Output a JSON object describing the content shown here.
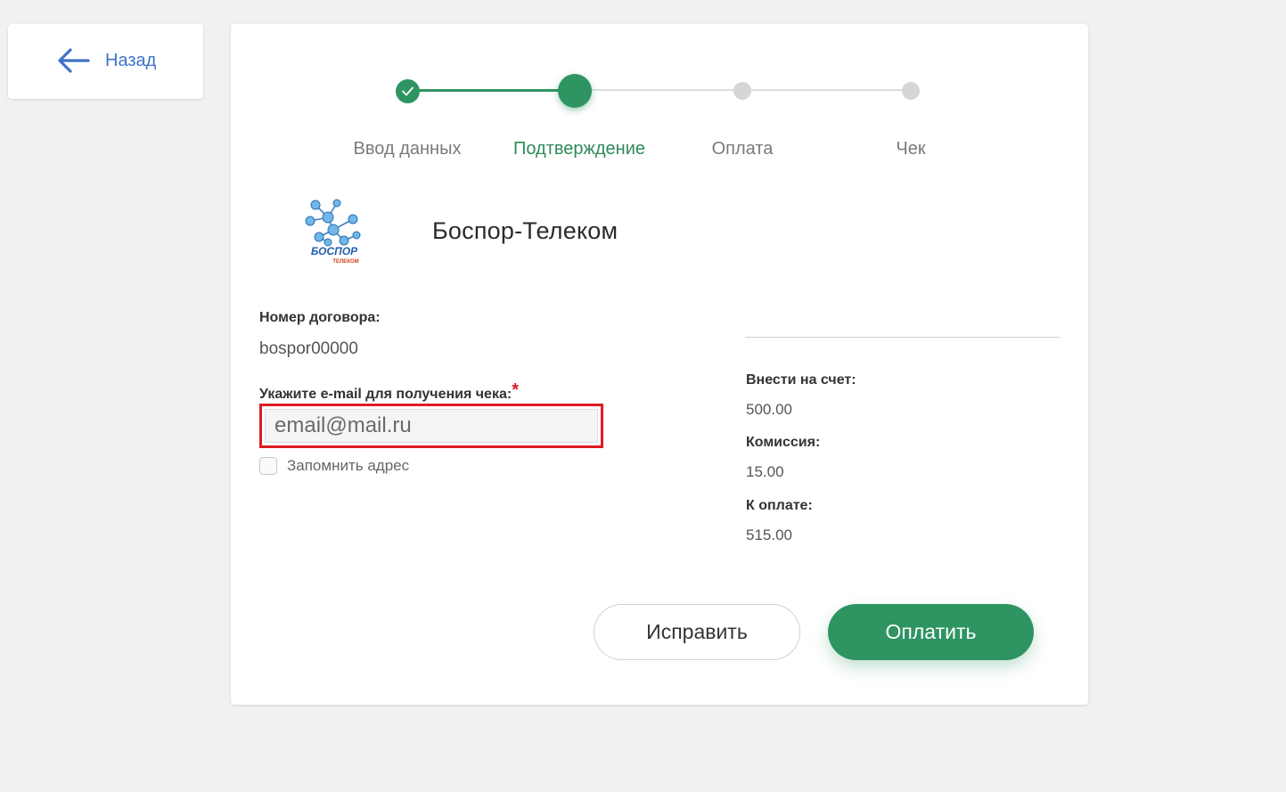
{
  "back": {
    "label": "Назад",
    "icon": "arrow-left-icon"
  },
  "stepper": {
    "steps": [
      {
        "label": "Ввод данных",
        "state": "done"
      },
      {
        "label": "Подтверждение",
        "state": "current"
      },
      {
        "label": "Оплата",
        "state": "todo"
      },
      {
        "label": "Чек",
        "state": "todo"
      }
    ],
    "colors": {
      "active": "#2e9462",
      "inactive": "#d6d6d6"
    }
  },
  "provider": {
    "name": "Боспор-Телеком",
    "logo_text": "БОСПОР",
    "logo_subtext": "ТЕЛЕКОМ"
  },
  "contract": {
    "label": "Номер договора:",
    "value": "bospor00000"
  },
  "email": {
    "label": "Укажите e-mail для получения чека:",
    "required_mark": "*",
    "placeholder": "email@mail.ru",
    "value": ""
  },
  "remember": {
    "label": "Запомнить адрес",
    "checked": false
  },
  "summary": {
    "deposit_label": "Внести на счет:",
    "deposit_value": "500.00",
    "commission_label": "Комиссия:",
    "commission_value": "15.00",
    "total_label": "К оплате:",
    "total_value": "515.00"
  },
  "actions": {
    "fix_label": "Исправить",
    "pay_label": "Оплатить"
  }
}
